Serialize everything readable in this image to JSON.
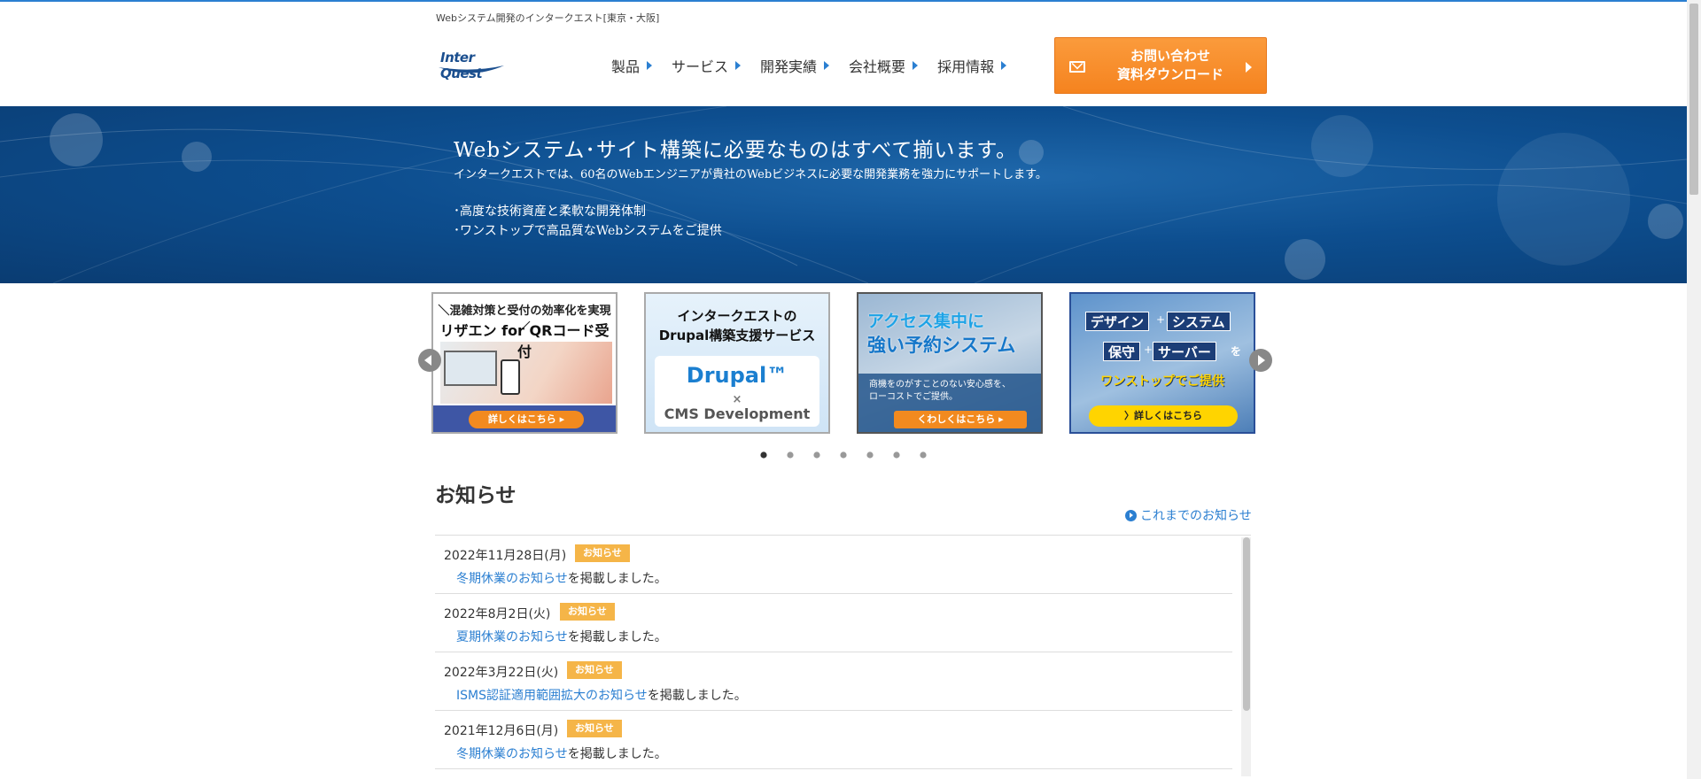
{
  "header": {
    "tagline": "Webシステム開発のインタークエスト[東京・大阪]",
    "logo_text": "Inter Quest",
    "nav": [
      {
        "label": "製品"
      },
      {
        "label": "サービス"
      },
      {
        "label": "開発実績"
      },
      {
        "label": "会社概要"
      },
      {
        "label": "採用情報"
      }
    ],
    "contact_line1": "お問い合わせ",
    "contact_line2": "資料ダウンロード",
    "accent_color": "#2b7fd1",
    "cta_color": "#f5831f"
  },
  "hero": {
    "title": "Webシステム･サイト構築に必要なものはすべて揃います。",
    "subtitle": "インタークエストでは、60名のWebエンジニアが貴社のWebビジネスに必要な開発業務を強力にサポートします。",
    "bullet1": "･高度な技術資産と柔軟な開発体制",
    "bullet2": "･ワンストップで高品質なWebシステムをご提供"
  },
  "slider": {
    "cards": [
      {
        "line1": "＼混雑対策と受付の効率化を実現／",
        "line2": "リザエン for QRコード受付",
        "button": "詳しくはこちら ▸"
      },
      {
        "line1": "インタークエストの",
        "line2": "Drupal構築支援サービス",
        "brand": "Drupal™",
        "x": "×",
        "cms": "CMS Development"
      },
      {
        "line1": "アクセス集中に",
        "line2": "強い予約システム",
        "desc1": "商機をのがすことのない安心感を、",
        "desc2": "ローコストでご提供。",
        "button": "くわしくはこちら ▸"
      },
      {
        "tag1": "デザイン",
        "tag2": "システム",
        "tag3": "保守",
        "tag4": "サーバー",
        "plus": "+",
        "wo": "を",
        "line1": "ワンストップでご提供",
        "button": "〉詳しくはこちら"
      }
    ],
    "page_count": 7,
    "active_index": 0
  },
  "news": {
    "heading": "お知らせ",
    "all_link": "これまでのお知らせ",
    "items": [
      {
        "date": "2022年11月28日(月)",
        "badge": "お知らせ",
        "link": "冬期休業のお知らせ",
        "suffix": "を掲載しました。"
      },
      {
        "date": "2022年8月2日(火)",
        "badge": "お知らせ",
        "link": "夏期休業のお知らせ",
        "suffix": "を掲載しました。"
      },
      {
        "date": "2022年3月22日(火)",
        "badge": "お知らせ",
        "link": "ISMS認証適用範囲拡大のお知らせ",
        "suffix": "を掲載しました。"
      },
      {
        "date": "2021年12月6日(月)",
        "badge": "お知らせ",
        "link": "冬期休業のお知らせ",
        "suffix": "を掲載しました。"
      }
    ]
  }
}
